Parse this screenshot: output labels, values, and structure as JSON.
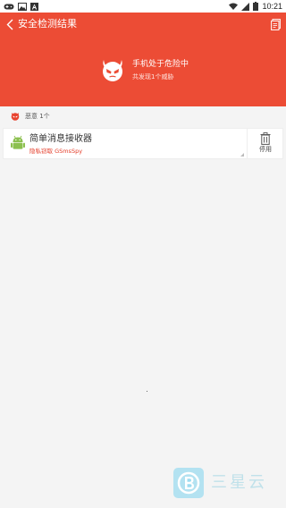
{
  "status_bar": {
    "time": "10:21",
    "left_icons": [
      "gamepad-icon",
      "image-icon",
      "font-icon"
    ],
    "right_icons": [
      "wifi-icon",
      "signal-icon",
      "battery-icon"
    ]
  },
  "header": {
    "title": "安全检测结果",
    "threat_title": "手机处于危险中",
    "threat_subtitle": "共发现1个威胁",
    "background_color": "#ec4c35"
  },
  "category": {
    "label": "恶意 1个"
  },
  "apps": [
    {
      "name": "简单消息接收器",
      "risk": "隐私窃取 GSmsSpy",
      "action_label": "停用"
    }
  ],
  "watermark": {
    "text": "三星云"
  }
}
